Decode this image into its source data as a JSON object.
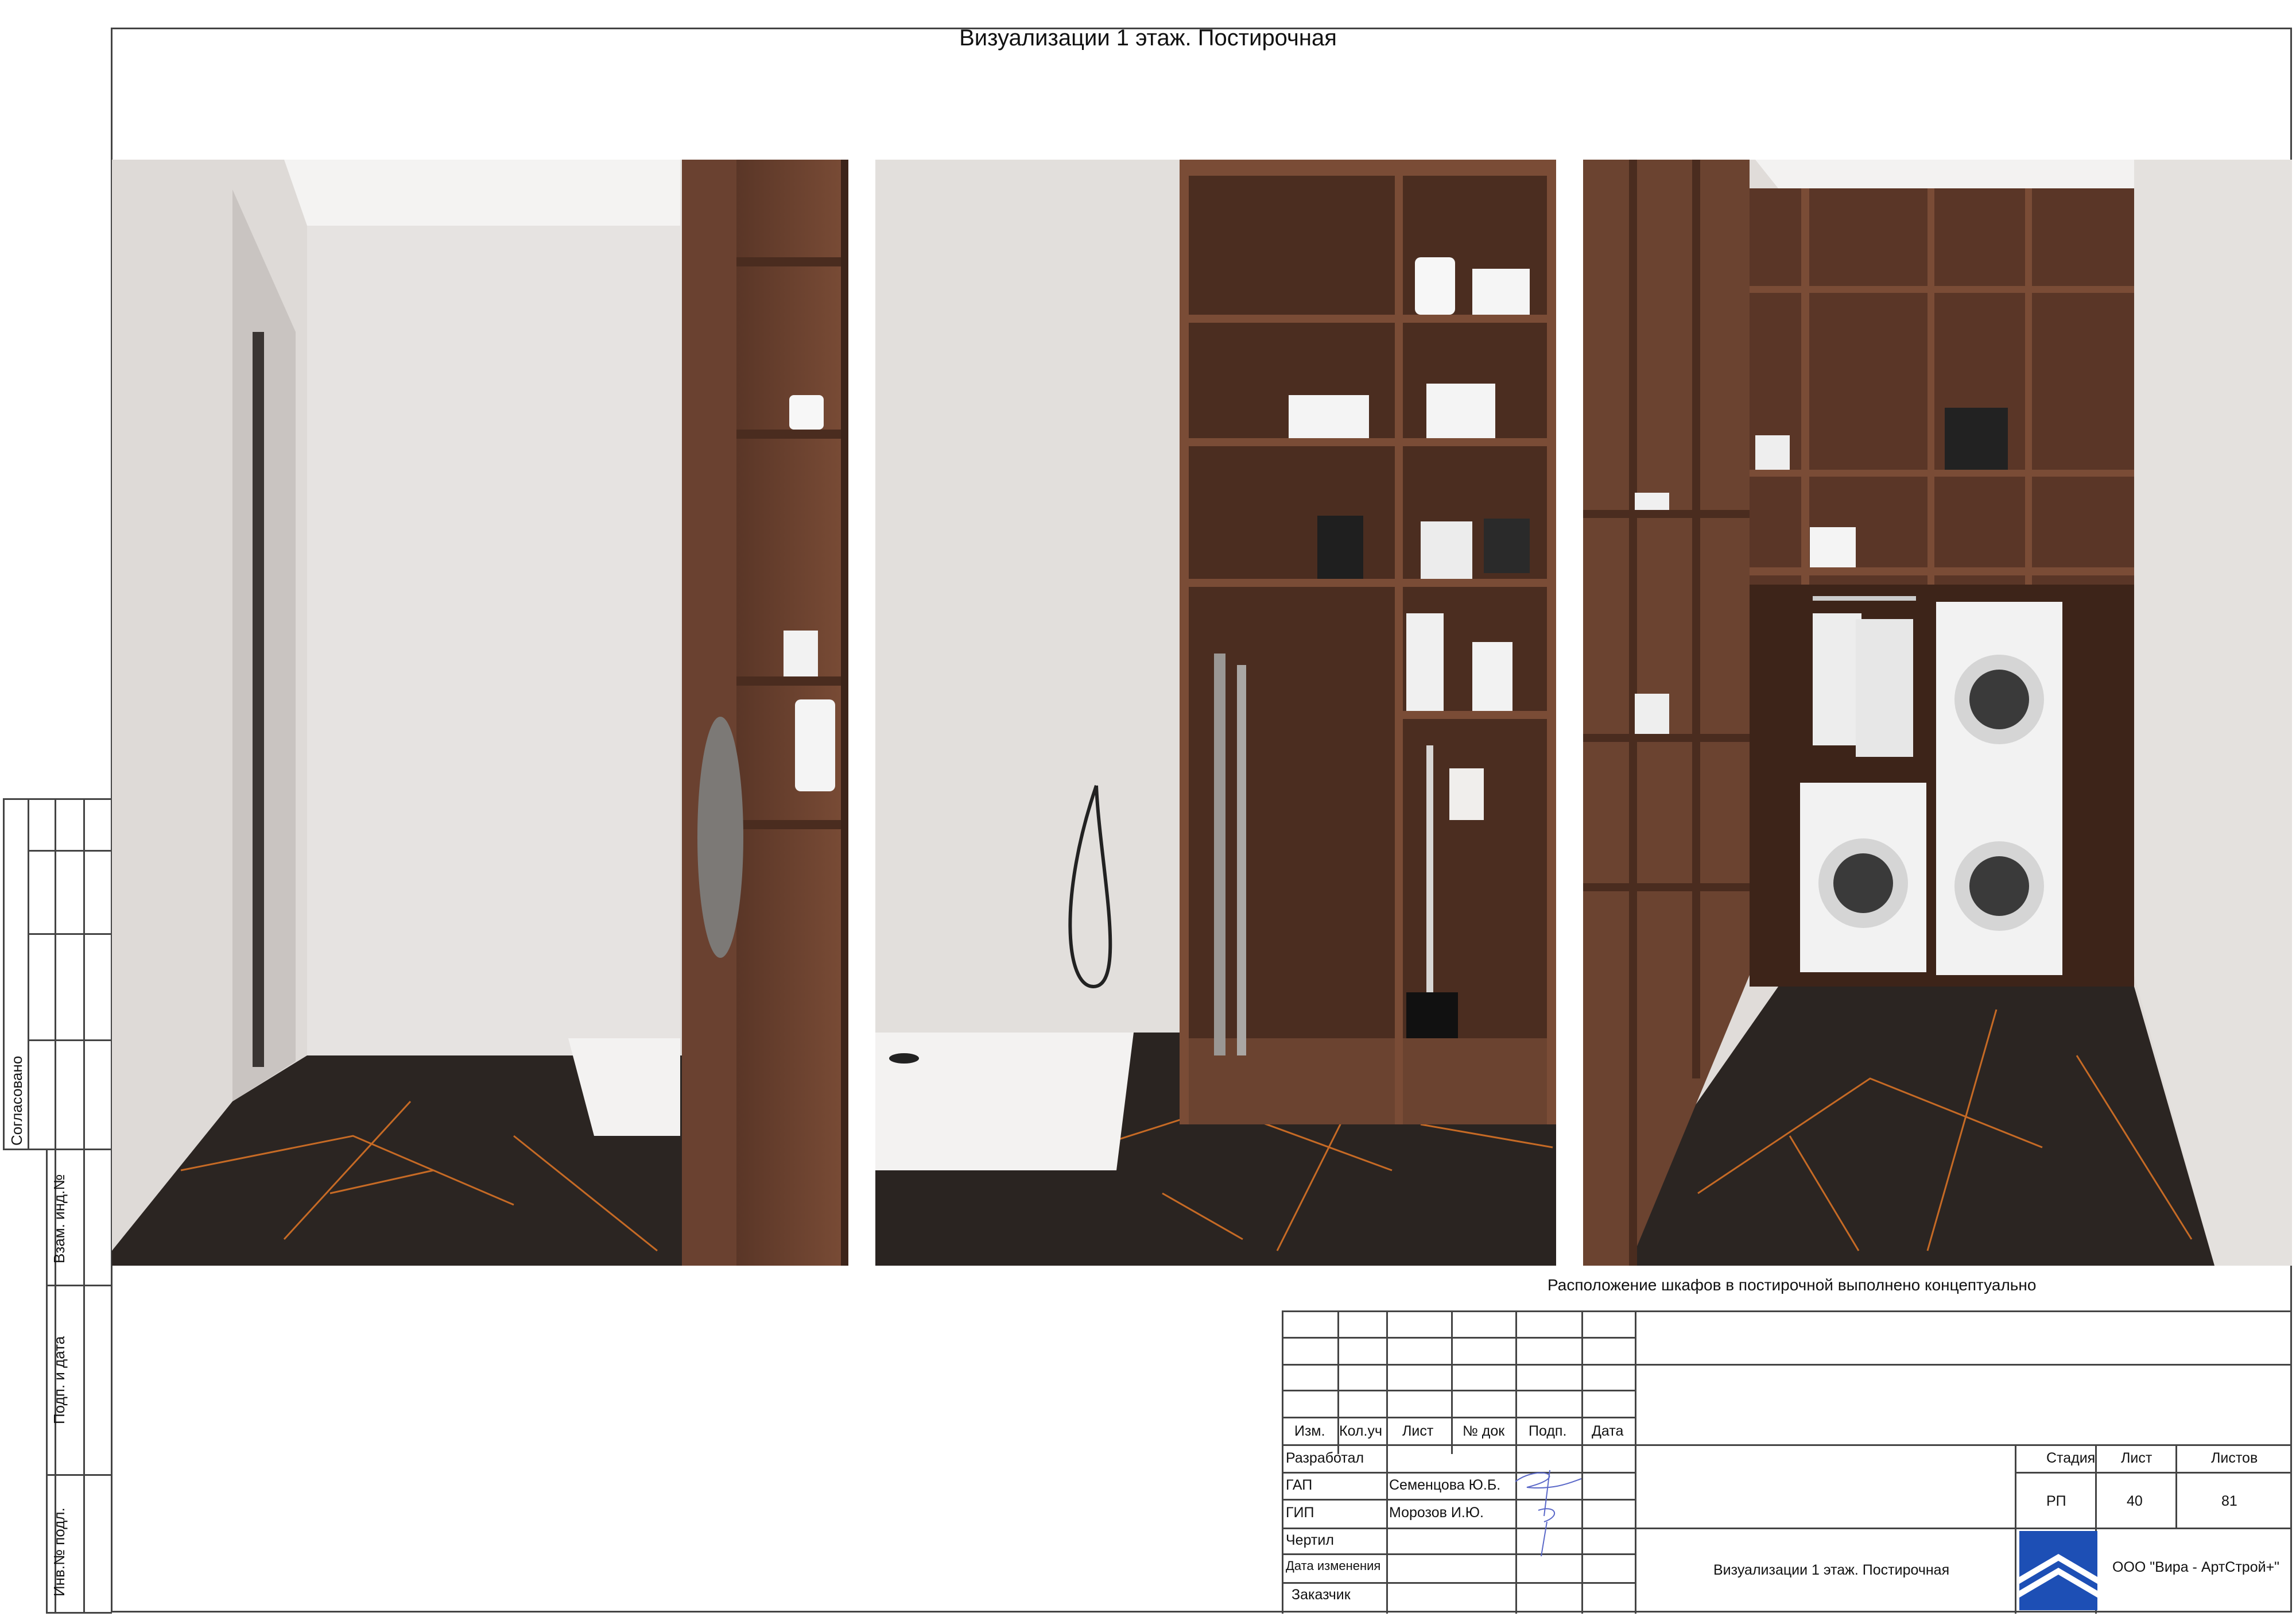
{
  "header": {
    "title": "Визуализации 1 этаж. Постирочная"
  },
  "caption": "Расположение шкафов в постирочной выполнено концептуально",
  "side_stamps": {
    "approved": "Согласовано",
    "inv_ref": "Взам. инд.№",
    "sign_date": "Подп. и дата",
    "inv_orig": "Инв.№ подл."
  },
  "title_block": {
    "columns": [
      "Изм.",
      "Кол.уч",
      "Лист",
      "№ док",
      "Подп.",
      "Дата"
    ],
    "roles": {
      "developed": "Разработал",
      "gap": "ГАП",
      "gip": "ГИП",
      "drew": "Чертил",
      "changed": "Дата изменения",
      "customer": "Заказчик"
    },
    "names": {
      "gap": "Семенцова Ю.Б.",
      "gip": "Морозов И.Ю."
    },
    "sheet_title": "Визуализации 1 этаж. Постирочная",
    "stage_label": "Стадия",
    "sheet_label": "Лист",
    "sheets_label": "Листов",
    "stage": "РП",
    "sheet": "40",
    "sheets": "81",
    "company": "ООО \"Вира - АртСтрой+\""
  },
  "renders": [
    {
      "view": "laundry-view-left"
    },
    {
      "view": "laundry-view-center"
    },
    {
      "view": "laundry-view-right"
    }
  ],
  "colors": {
    "wall": "#e4e1df",
    "wood": "#6b4330",
    "floor": "#2b2522",
    "vein": "#c66a25",
    "logo": "#1d4fb5"
  }
}
